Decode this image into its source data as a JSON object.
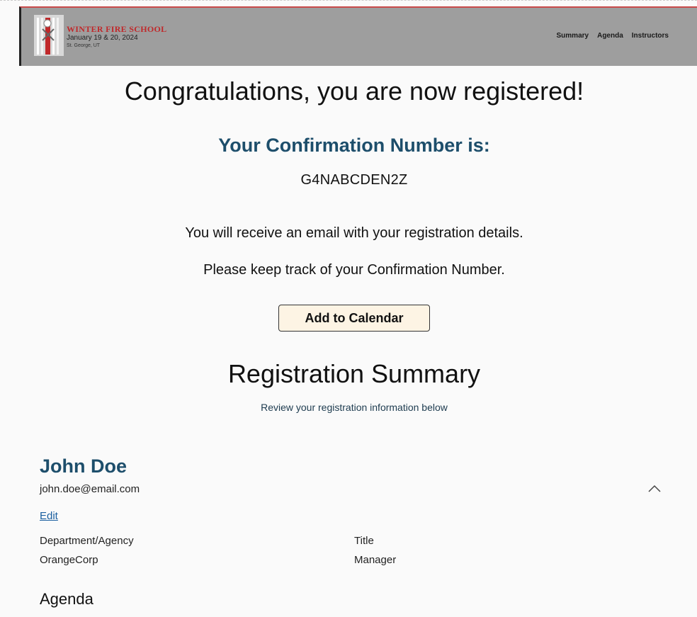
{
  "header": {
    "brand_title": "WINTER FIRE SCHOOL",
    "brand_dates": "January 19 & 20, 2024",
    "brand_location": "St. George, UT",
    "nav": [
      "Summary",
      "Agenda",
      "Instructors"
    ]
  },
  "confirmation": {
    "heading": "Congratulations, you are now registered!",
    "number_label": "Your Confirmation Number is:",
    "number": "G4NABCDEN2Z",
    "email_notice": "You will receive an email with your registration details.",
    "track_notice": "Please keep track of your Confirmation Number.",
    "calendar_button": "Add to Calendar"
  },
  "summary": {
    "title": "Registration Summary",
    "subtitle": "Review your registration information below"
  },
  "registrant": {
    "name": "John Doe",
    "email": "john.doe@email.com",
    "edit_label": "Edit",
    "department_label": "Department/Agency",
    "department_value": "OrangeCorp",
    "title_label": "Title",
    "title_value": "Manager",
    "agenda_heading": "Agenda"
  },
  "icons": {
    "collapse": "chevron-up-icon",
    "logo": "fire-school-logo"
  },
  "colors": {
    "accent": "#1d4e6b",
    "brand_red": "#c0282a",
    "link": "#1a5fa0",
    "button_bg": "#fdf4e4",
    "header_bg": "#9e9e9e"
  }
}
